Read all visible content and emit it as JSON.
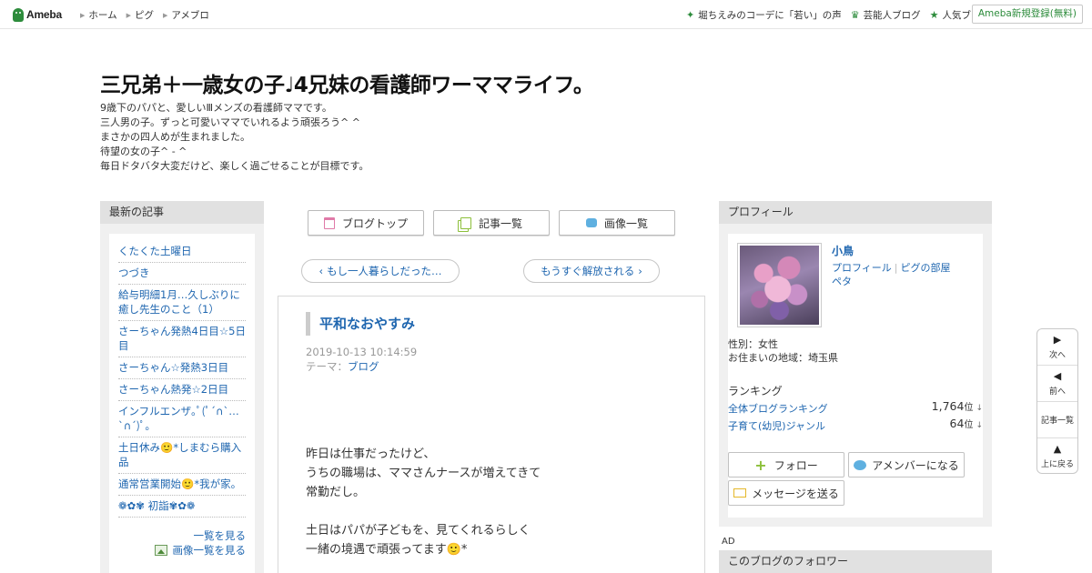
{
  "topbar": {
    "logo_text": "Ameba",
    "nav": [
      "ホーム",
      "ピグ",
      "アメブロ"
    ],
    "right_links": [
      {
        "icon": "sparkle-icon",
        "label": "堀ちえみのコーデに「若い」の声"
      },
      {
        "icon": "crown-icon",
        "label": "芸能人ブログ"
      },
      {
        "icon": "star-icon",
        "label": "人気ブログ"
      }
    ],
    "register_label": "Ameba新規登録(無料)"
  },
  "header": {
    "title": "三兄弟＋一歳女の子♩4兄妹の看護師ワーママライフ。",
    "description": [
      "9歳下のパパと、愛しいⅢメンズの看護師ママです。",
      "三人男の子。ずっと可愛いママでいれるよう頑張ろう^ ^",
      "まさかの四人めが生まれました。",
      "待望の女の子^ - ^",
      "毎日ドタバタ大変だけど、楽しく過ごせることが目標です。"
    ]
  },
  "recent": {
    "heading": "最新の記事",
    "items": [
      "くたくた土曜日",
      "つづき",
      "給与明細1月…久しぶりに癒し先生のこと（1）",
      "さーちゃん発熱4日目☆5日目",
      "さーちゃん☆発熱3日目",
      "さーちゃん熱発☆2日目",
      "インフルエンザ｡ﾟ(ﾟ´∩`…`∩´)ﾟ｡",
      "土日休み🙂*しまむら購入品",
      "通常営業開始🙂*我が家。",
      "❁✿✾ 初詣✾✿❁"
    ],
    "more_label": "一覧を見る",
    "images_label": "画像一覧を見る"
  },
  "center": {
    "buttons": {
      "blog_top": "ブログトップ",
      "entry_list": "記事一覧",
      "image_list": "画像一覧"
    },
    "prev_label": "もし一人暮らしだった…",
    "next_label": "もうすぐ解放される",
    "article": {
      "title": "平和なおやすみ",
      "date": "2019-10-13 10:14:59",
      "theme_label": "テーマ：",
      "theme": "ブログ",
      "body": "昨日は仕事だったけど、\nうちの職場は、ママさんナースが増えてきて\n常勤だし。\n\n土日はパパが子どもを、見てくれるらしく\n一緒の境遇で頑張ってます🙂*"
    }
  },
  "profile": {
    "heading": "プロフィール",
    "name": "小鳥",
    "link_profile": "プロフィール",
    "link_pig": "ピグの部屋",
    "link_peta": "ペタ",
    "gender": "性別：女性",
    "area": "お住まいの地域：埼玉県",
    "ranking_title": "ランキング",
    "rankings": [
      {
        "label": "全体ブログランキング",
        "value": "1,764",
        "unit": "位",
        "trend": "↓"
      },
      {
        "label": "子育て(幼児)ジャンル",
        "value": "64",
        "unit": "位",
        "trend": "↓"
      }
    ],
    "follow_label": "フォロー",
    "amember_label": "アメンバーになる",
    "message_label": "メッセージを送る"
  },
  "ad_label": "AD",
  "followers_heading": "このブログのフォロワー",
  "float_nav": {
    "next": "次へ",
    "prev": "前へ",
    "list": "記事一覧",
    "top": "上に戻る"
  },
  "colors": {
    "brand_green": "#2d8c3c",
    "link_blue": "#2067b0"
  }
}
